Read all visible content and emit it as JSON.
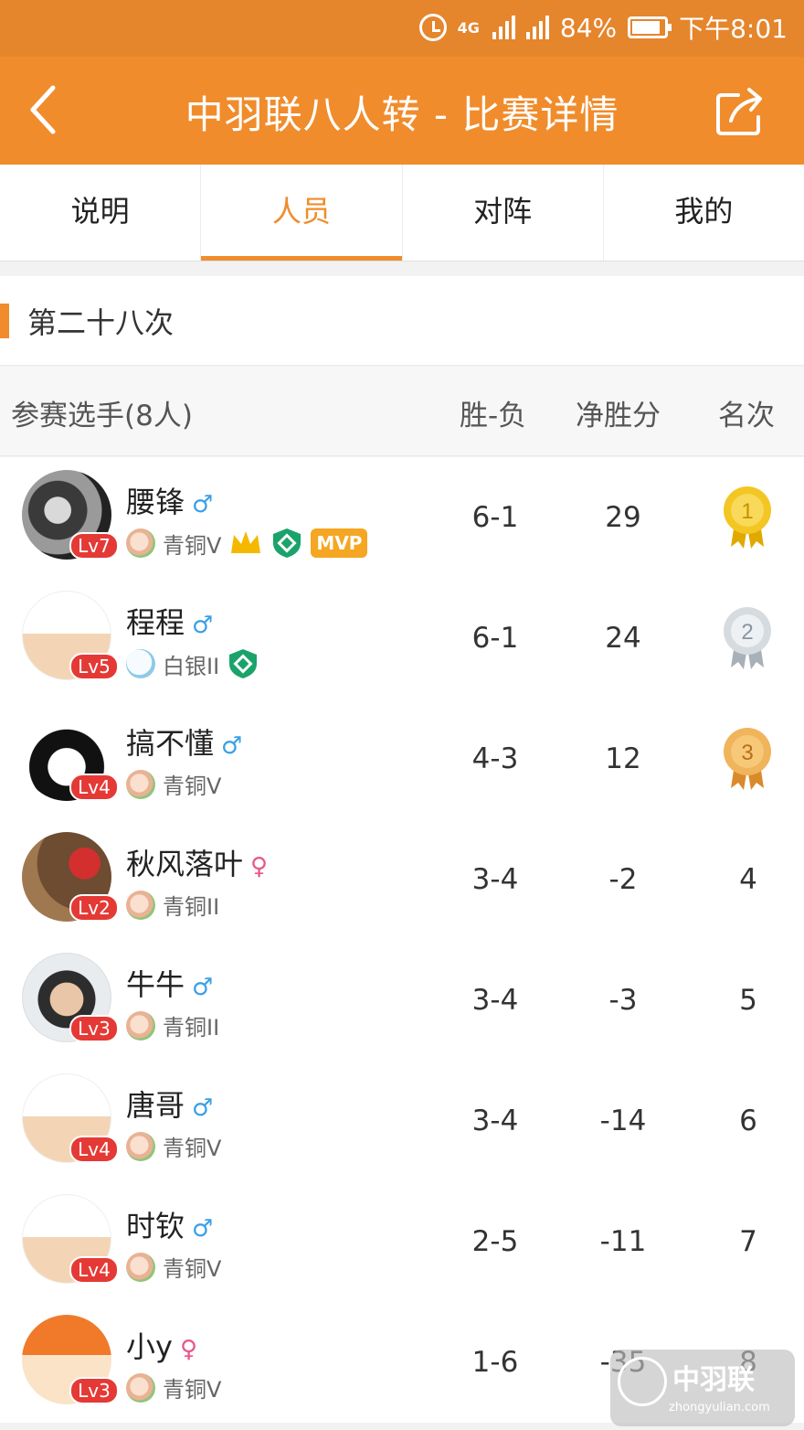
{
  "statusbar": {
    "network": "4G",
    "battery": "84%",
    "time": "下午8:01"
  },
  "header": {
    "title": "中羽联八人转 - 比赛详情"
  },
  "tabs": [
    {
      "label": "说明"
    },
    {
      "label": "人员"
    },
    {
      "label": "对阵"
    },
    {
      "label": "我的"
    }
  ],
  "section": {
    "title": "第二十八次"
  },
  "table": {
    "columns": {
      "player": "参赛选手(8人)",
      "record": "胜-负",
      "net": "净胜分",
      "rank": "名次"
    },
    "rows": [
      {
        "name": "腰锋",
        "gender": "♂",
        "level": "Lv7",
        "rank_title": "青铜V",
        "record": "6-1",
        "net": "29",
        "place": "1",
        "mvp": "MVP"
      },
      {
        "name": "程程",
        "gender": "♂",
        "level": "Lv5",
        "rank_title": "白银II",
        "record": "6-1",
        "net": "24",
        "place": "2"
      },
      {
        "name": "搞不懂",
        "gender": "♂",
        "level": "Lv4",
        "rank_title": "青铜V",
        "record": "4-3",
        "net": "12",
        "place": "3"
      },
      {
        "name": "秋风落叶",
        "gender": "♀",
        "level": "Lv2",
        "rank_title": "青铜II",
        "record": "3-4",
        "net": "-2",
        "place": "4"
      },
      {
        "name": "牛牛",
        "gender": "♂",
        "level": "Lv3",
        "rank_title": "青铜II",
        "record": "3-4",
        "net": "-3",
        "place": "5"
      },
      {
        "name": "唐哥",
        "gender": "♂",
        "level": "Lv4",
        "rank_title": "青铜V",
        "record": "3-4",
        "net": "-14",
        "place": "6"
      },
      {
        "name": "时钦",
        "gender": "♂",
        "level": "Lv4",
        "rank_title": "青铜V",
        "record": "2-5",
        "net": "-11",
        "place": "7"
      },
      {
        "name": "小y",
        "gender": "♀",
        "level": "Lv3",
        "rank_title": "青铜V",
        "record": "1-6",
        "net": "-35",
        "place": "8"
      }
    ]
  },
  "watermark": {
    "text": "中羽联",
    "url": "zhongyulian.com"
  },
  "colors": {
    "accent": "#f08c2c",
    "statusbar": "#e5852c",
    "level_badge": "#e53935",
    "male": "#3aa0e6",
    "female": "#e8578c"
  }
}
